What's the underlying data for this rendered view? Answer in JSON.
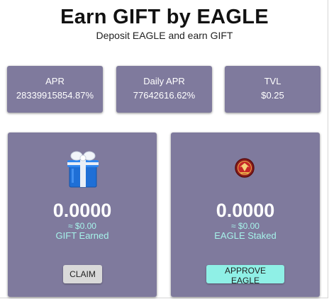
{
  "header": {
    "title": "Earn GIFT by EAGLE",
    "subtitle": "Deposit EAGLE and earn GIFT"
  },
  "stats": [
    {
      "label": "APR",
      "value": "28339915854.87%"
    },
    {
      "label": "Daily APR",
      "value": "77642616.62%"
    },
    {
      "label": "TVL",
      "value": "$0.25"
    }
  ],
  "earn_card": {
    "icon": "gift-box-icon",
    "amount": "0.0000",
    "usd": "≈ $0.00",
    "caption": "GIFT Earned",
    "button_label": "CLAIM"
  },
  "stake_card": {
    "icon": "eagle-token-icon",
    "amount": "0.0000",
    "usd": "≈ $0.00",
    "caption": "EAGLE Staked",
    "button_label": "APPROVE EAGLE"
  },
  "colors": {
    "card_bg": "#7f7a9d",
    "accent": "#a6f3ea",
    "approve_button": "#8ff0e6",
    "claim_button": "#d9d9d9"
  }
}
